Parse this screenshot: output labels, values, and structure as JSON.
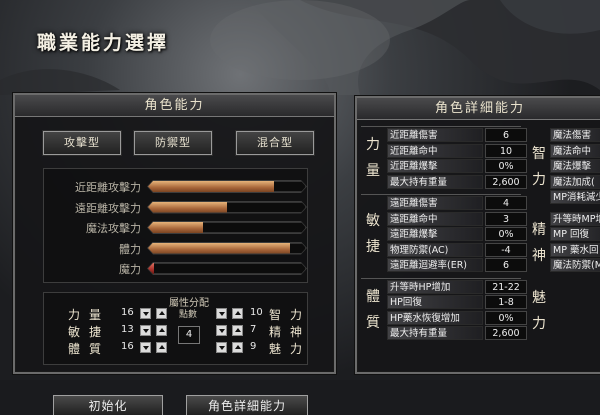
{
  "window": {
    "title": "職業能力選擇"
  },
  "left_panel": {
    "title": "角色能力",
    "class_buttons": [
      "攻擊型",
      "防禦型",
      "混合型"
    ],
    "stats": [
      {
        "label": "近距離攻擊力",
        "value": 0.8,
        "color": "#b8743e"
      },
      {
        "label": "遠距離攻擊力",
        "value": 0.5,
        "color": "#b8743e"
      },
      {
        "label": "魔法攻擊力",
        "value": 0.35,
        "color": "#b8743e"
      },
      {
        "label": "體力",
        "value": 0.9,
        "color": "#b8743e"
      },
      {
        "label": "魔力",
        "value": 0.04,
        "color": "#c0392b"
      }
    ],
    "allocation": {
      "title": "屬性分配",
      "points_label": "點數",
      "points": "4",
      "left": [
        {
          "name": "力量",
          "value": "16"
        },
        {
          "name": "敏捷",
          "value": "13"
        },
        {
          "name": "體質",
          "value": "16"
        }
      ],
      "right": [
        {
          "name": "智力",
          "value": "10"
        },
        {
          "name": "精神",
          "value": "7"
        },
        {
          "name": "魅力",
          "value": "9"
        }
      ]
    }
  },
  "buttons": {
    "reset": "初始化",
    "detail": "角色詳細能力"
  },
  "right_panel": {
    "title": "角色詳細能力",
    "left_groups": [
      {
        "label": "力量",
        "rows": [
          {
            "name": "近距離傷害",
            "value": "6"
          },
          {
            "name": "近距離命中",
            "value": "10"
          },
          {
            "name": "近距離爆擊",
            "value": "0%"
          },
          {
            "name": "最大持有重量",
            "value": "2,600"
          }
        ]
      },
      {
        "label": "敏捷",
        "rows": [
          {
            "name": "遠距離傷害",
            "value": "4"
          },
          {
            "name": "遠距離命中",
            "value": "3"
          },
          {
            "name": "遠距離爆擊",
            "value": "0%"
          },
          {
            "name": "物理防禦(AC)",
            "value": "-4"
          },
          {
            "name": "遠距離迴避率(ER)",
            "value": "6"
          }
        ]
      },
      {
        "label": "體質",
        "rows": [
          {
            "name": "升等時HP增加",
            "value": "21-22"
          },
          {
            "name": "HP回復",
            "value": "1-8"
          },
          {
            "name": "HP藥水恢復增加",
            "value": "0%"
          },
          {
            "name": "最大持有重量",
            "value": "2,600"
          }
        ]
      }
    ],
    "right_groups": [
      {
        "label": "智力",
        "rows": [
          {
            "name": "魔法傷害"
          },
          {
            "name": "魔法命中"
          },
          {
            "name": "魔法爆擊"
          },
          {
            "name": "魔法加成("
          },
          {
            "name": "MP消耗減少"
          }
        ]
      },
      {
        "label": "精神",
        "rows": [
          {
            "name": "升等時MP增"
          },
          {
            "name": "MP 回復"
          },
          {
            "name": "MP 藥水回"
          },
          {
            "name": "魔法防禦(M"
          }
        ]
      },
      {
        "label": "魅力",
        "rows": []
      }
    ]
  }
}
